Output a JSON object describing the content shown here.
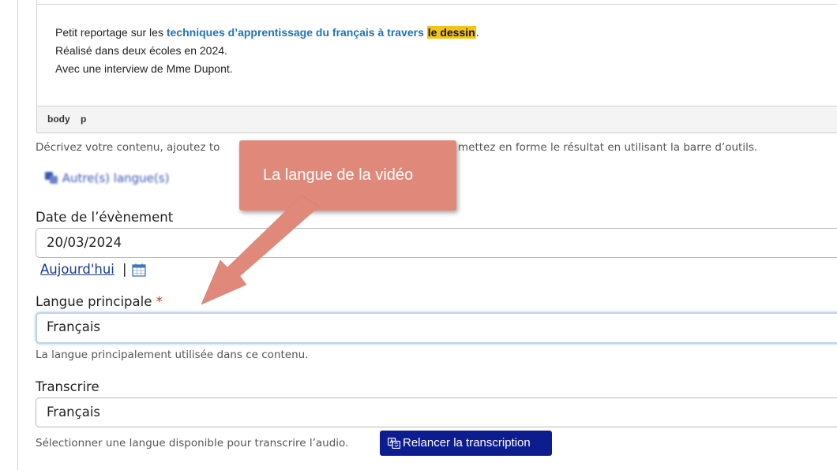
{
  "editor": {
    "line1_prefix": "Petit reportage sur les ",
    "line1_link": "techniques d’apprentissage du français à travers",
    "line1_space": " ",
    "line1_highlight": "le dessin",
    "line1_suffix": ".",
    "line2": "Réalisé dans deux écoles en 2024.",
    "line3": "Avec une interview de Mme Dupont.",
    "statusbar": [
      "body",
      "p"
    ]
  },
  "description": {
    "help_left": "Décrivez votre contenu, ajoutez to",
    "help_right": "mettez en forme le résultat en utilisant la barre d’outils.",
    "other_languages": "Autre(s) langue(s)"
  },
  "event_date": {
    "label": "Date de l’évènement",
    "value": "20/03/2024",
    "today_link": "Aujourd'hui",
    "separator": "|"
  },
  "main_language": {
    "label": "Langue principale",
    "required_mark": "*",
    "value": "Français",
    "help": "La langue principalement utilisée dans ce contenu."
  },
  "transcribe": {
    "label": "Transcrire",
    "value": "Français",
    "help": "Sélectionner une langue disponible pour transcrire l’audio.",
    "button": "Relancer la transcription"
  },
  "callout": {
    "text": "La langue de la vidéo",
    "color": "#e0897a"
  },
  "colors": {
    "link": "#1f73b7",
    "highlight": "#f2c418",
    "button": "#0d1d8f",
    "required": "#c0392b"
  },
  "icons": {
    "other_languages": "translate-icon",
    "date_picker": "calendar-icon",
    "button": "transcribe-icon"
  }
}
